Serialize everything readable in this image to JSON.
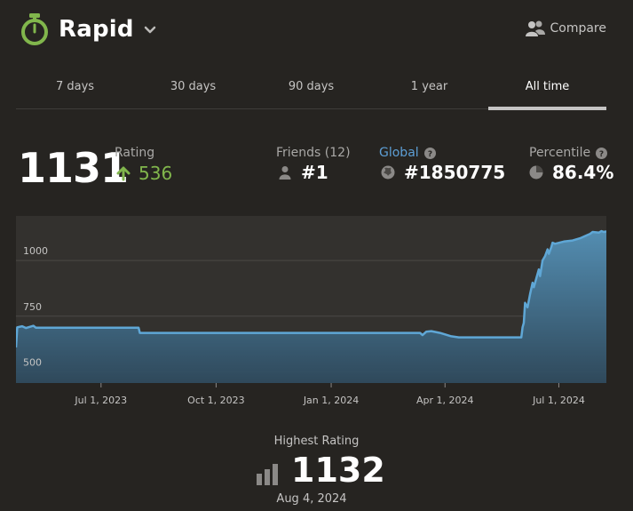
{
  "header": {
    "title": "Rapid",
    "compare_label": "Compare"
  },
  "tabs": [
    {
      "label": "7 days",
      "active": false
    },
    {
      "label": "30 days",
      "active": false
    },
    {
      "label": "90 days",
      "active": false
    },
    {
      "label": "1 year",
      "active": false
    },
    {
      "label": "All time",
      "active": true
    }
  ],
  "stats": {
    "rating": "1131",
    "rating_label": "Rating",
    "rating_change": "536",
    "friends_label": "Friends (12)",
    "friends_rank": "#1",
    "global_label": "Global",
    "global_rank": "#1850775",
    "percentile_label": "Percentile",
    "percentile_value": "86.4%"
  },
  "highest": {
    "label": "Highest Rating",
    "value": "1132",
    "date": "Aug 4, 2024"
  },
  "colors": {
    "accent_green": "#81b64c",
    "global_blue": "#5d9fd6",
    "line": "#5fa7d6",
    "background": "#262421"
  },
  "chart_data": {
    "type": "area",
    "xlabel": "",
    "ylabel": "",
    "grid": true,
    "yticks": [
      {
        "value": 500,
        "label": "500"
      },
      {
        "value": 750,
        "label": "750"
      },
      {
        "value": 1000,
        "label": "1000"
      }
    ],
    "xticks": [
      {
        "value": "2023-07-01",
        "label": "Jul 1, 2023"
      },
      {
        "value": "2023-10-01",
        "label": "Oct 1, 2023"
      },
      {
        "value": "2024-01-01",
        "label": "Jan 1, 2024"
      },
      {
        "value": "2024-04-01",
        "label": "Apr 1, 2024"
      },
      {
        "value": "2024-07-01",
        "label": "Jul 1, 2024"
      }
    ],
    "xlim": [
      "2023-04-24",
      "2024-08-08"
    ],
    "ylim": [
      450,
      1200
    ],
    "series": [
      {
        "points": [
          [
            "2023-04-24",
            610
          ],
          [
            "2023-04-25",
            700
          ],
          [
            "2023-04-29",
            705
          ],
          [
            "2023-05-02",
            697
          ],
          [
            "2023-05-05",
            702
          ],
          [
            "2023-05-08",
            707
          ],
          [
            "2023-05-10",
            698
          ],
          [
            "2023-06-15",
            698
          ],
          [
            "2023-07-20",
            698
          ],
          [
            "2023-07-31",
            698
          ],
          [
            "2023-08-01",
            675
          ],
          [
            "2024-03-01",
            675
          ],
          [
            "2024-03-12",
            675
          ],
          [
            "2024-03-14",
            665
          ],
          [
            "2024-03-17",
            680
          ],
          [
            "2024-03-21",
            683
          ],
          [
            "2024-03-28",
            675
          ],
          [
            "2024-04-06",
            660
          ],
          [
            "2024-04-12",
            655
          ],
          [
            "2024-05-20",
            655
          ],
          [
            "2024-06-01",
            655
          ],
          [
            "2024-06-02",
            700
          ],
          [
            "2024-06-03",
            720
          ],
          [
            "2024-06-04",
            810
          ],
          [
            "2024-06-06",
            790
          ],
          [
            "2024-06-08",
            850
          ],
          [
            "2024-06-10",
            900
          ],
          [
            "2024-06-11",
            880
          ],
          [
            "2024-06-13",
            920
          ],
          [
            "2024-06-15",
            960
          ],
          [
            "2024-06-16",
            930
          ],
          [
            "2024-06-18",
            1000
          ],
          [
            "2024-06-20",
            1020
          ],
          [
            "2024-06-22",
            1050
          ],
          [
            "2024-06-23",
            1030
          ],
          [
            "2024-06-25",
            1060
          ],
          [
            "2024-06-26",
            1080
          ],
          [
            "2024-06-28",
            1075
          ],
          [
            "2024-07-05",
            1085
          ],
          [
            "2024-07-12",
            1090
          ],
          [
            "2024-07-18",
            1100
          ],
          [
            "2024-07-22",
            1110
          ],
          [
            "2024-07-26",
            1120
          ],
          [
            "2024-07-28",
            1128
          ],
          [
            "2024-08-02",
            1125
          ],
          [
            "2024-08-04",
            1132
          ],
          [
            "2024-08-06",
            1128
          ],
          [
            "2024-08-08",
            1131
          ]
        ]
      }
    ]
  }
}
